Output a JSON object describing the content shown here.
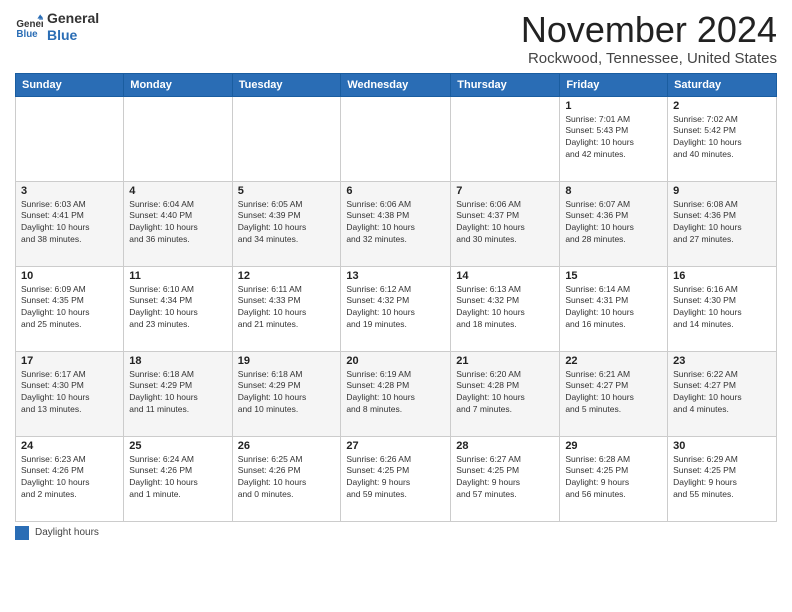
{
  "header": {
    "logo_general": "General",
    "logo_blue": "Blue",
    "month_title": "November 2024",
    "location": "Rockwood, Tennessee, United States"
  },
  "days_of_week": [
    "Sunday",
    "Monday",
    "Tuesday",
    "Wednesday",
    "Thursday",
    "Friday",
    "Saturday"
  ],
  "weeks": [
    [
      {
        "day": "",
        "info": ""
      },
      {
        "day": "",
        "info": ""
      },
      {
        "day": "",
        "info": ""
      },
      {
        "day": "",
        "info": ""
      },
      {
        "day": "",
        "info": ""
      },
      {
        "day": "1",
        "info": "Sunrise: 7:01 AM\nSunset: 5:43 PM\nDaylight: 10 hours\nand 42 minutes."
      },
      {
        "day": "2",
        "info": "Sunrise: 7:02 AM\nSunset: 5:42 PM\nDaylight: 10 hours\nand 40 minutes."
      }
    ],
    [
      {
        "day": "3",
        "info": "Sunrise: 6:03 AM\nSunset: 4:41 PM\nDaylight: 10 hours\nand 38 minutes."
      },
      {
        "day": "4",
        "info": "Sunrise: 6:04 AM\nSunset: 4:40 PM\nDaylight: 10 hours\nand 36 minutes."
      },
      {
        "day": "5",
        "info": "Sunrise: 6:05 AM\nSunset: 4:39 PM\nDaylight: 10 hours\nand 34 minutes."
      },
      {
        "day": "6",
        "info": "Sunrise: 6:06 AM\nSunset: 4:38 PM\nDaylight: 10 hours\nand 32 minutes."
      },
      {
        "day": "7",
        "info": "Sunrise: 6:06 AM\nSunset: 4:37 PM\nDaylight: 10 hours\nand 30 minutes."
      },
      {
        "day": "8",
        "info": "Sunrise: 6:07 AM\nSunset: 4:36 PM\nDaylight: 10 hours\nand 28 minutes."
      },
      {
        "day": "9",
        "info": "Sunrise: 6:08 AM\nSunset: 4:36 PM\nDaylight: 10 hours\nand 27 minutes."
      }
    ],
    [
      {
        "day": "10",
        "info": "Sunrise: 6:09 AM\nSunset: 4:35 PM\nDaylight: 10 hours\nand 25 minutes."
      },
      {
        "day": "11",
        "info": "Sunrise: 6:10 AM\nSunset: 4:34 PM\nDaylight: 10 hours\nand 23 minutes."
      },
      {
        "day": "12",
        "info": "Sunrise: 6:11 AM\nSunset: 4:33 PM\nDaylight: 10 hours\nand 21 minutes."
      },
      {
        "day": "13",
        "info": "Sunrise: 6:12 AM\nSunset: 4:32 PM\nDaylight: 10 hours\nand 19 minutes."
      },
      {
        "day": "14",
        "info": "Sunrise: 6:13 AM\nSunset: 4:32 PM\nDaylight: 10 hours\nand 18 minutes."
      },
      {
        "day": "15",
        "info": "Sunrise: 6:14 AM\nSunset: 4:31 PM\nDaylight: 10 hours\nand 16 minutes."
      },
      {
        "day": "16",
        "info": "Sunrise: 6:16 AM\nSunset: 4:30 PM\nDaylight: 10 hours\nand 14 minutes."
      }
    ],
    [
      {
        "day": "17",
        "info": "Sunrise: 6:17 AM\nSunset: 4:30 PM\nDaylight: 10 hours\nand 13 minutes."
      },
      {
        "day": "18",
        "info": "Sunrise: 6:18 AM\nSunset: 4:29 PM\nDaylight: 10 hours\nand 11 minutes."
      },
      {
        "day": "19",
        "info": "Sunrise: 6:18 AM\nSunset: 4:29 PM\nDaylight: 10 hours\nand 10 minutes."
      },
      {
        "day": "20",
        "info": "Sunrise: 6:19 AM\nSunset: 4:28 PM\nDaylight: 10 hours\nand 8 minutes."
      },
      {
        "day": "21",
        "info": "Sunrise: 6:20 AM\nSunset: 4:28 PM\nDaylight: 10 hours\nand 7 minutes."
      },
      {
        "day": "22",
        "info": "Sunrise: 6:21 AM\nSunset: 4:27 PM\nDaylight: 10 hours\nand 5 minutes."
      },
      {
        "day": "23",
        "info": "Sunrise: 6:22 AM\nSunset: 4:27 PM\nDaylight: 10 hours\nand 4 minutes."
      }
    ],
    [
      {
        "day": "24",
        "info": "Sunrise: 6:23 AM\nSunset: 4:26 PM\nDaylight: 10 hours\nand 2 minutes."
      },
      {
        "day": "25",
        "info": "Sunrise: 6:24 AM\nSunset: 4:26 PM\nDaylight: 10 hours\nand 1 minute."
      },
      {
        "day": "26",
        "info": "Sunrise: 6:25 AM\nSunset: 4:26 PM\nDaylight: 10 hours\nand 0 minutes."
      },
      {
        "day": "27",
        "info": "Sunrise: 6:26 AM\nSunset: 4:25 PM\nDaylight: 9 hours\nand 59 minutes."
      },
      {
        "day": "28",
        "info": "Sunrise: 6:27 AM\nSunset: 4:25 PM\nDaylight: 9 hours\nand 57 minutes."
      },
      {
        "day": "29",
        "info": "Sunrise: 6:28 AM\nSunset: 4:25 PM\nDaylight: 9 hours\nand 56 minutes."
      },
      {
        "day": "30",
        "info": "Sunrise: 6:29 AM\nSunset: 4:25 PM\nDaylight: 9 hours\nand 55 minutes."
      }
    ]
  ],
  "legend": {
    "box_color": "#2a6db5",
    "label": "Daylight hours"
  }
}
